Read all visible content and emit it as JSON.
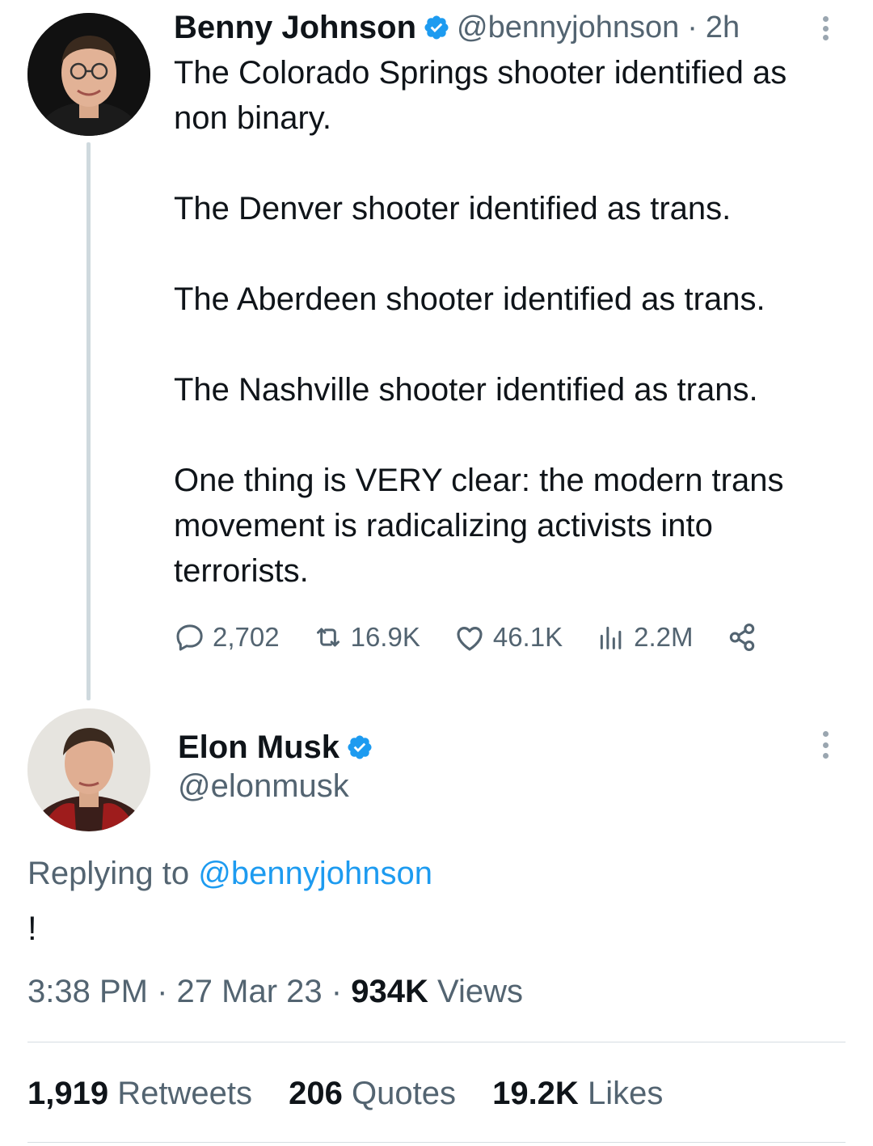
{
  "thread_post": {
    "author": {
      "display_name": "Benny Johnson",
      "handle": "@bennyjohnson",
      "separator": "·",
      "time": "2h"
    },
    "paragraphs": [
      "The Colorado Springs shooter identified as non binary.",
      "The Denver shooter identified as trans.",
      "The Aberdeen shooter identified as trans.",
      "The Nashville shooter identified as trans.",
      "One thing is VERY clear: the modern trans movement is radicalizing activists into terrorists."
    ],
    "actions": {
      "replies": "2,702",
      "retweets": "16.9K",
      "likes": "46.1K",
      "views": "2.2M"
    }
  },
  "reply_post": {
    "author": {
      "display_name": "Elon Musk",
      "handle": "@elonmusk"
    },
    "replying_to_label": "Replying to",
    "replying_to_handle": "@bennyjohnson",
    "text": "!",
    "meta": {
      "time": "3:38 PM",
      "separator": "·",
      "date": "27 Mar 23",
      "views_count": "934K",
      "views_label": "Views"
    },
    "stats": {
      "retweets_count": "1,919",
      "retweets_label": "Retweets",
      "quotes_count": "206",
      "quotes_label": "Quotes",
      "likes_count": "19.2K",
      "likes_label": "Likes"
    }
  },
  "colors": {
    "accent": "#1d9bf0",
    "secondary_text": "#536471",
    "primary_text": "#0f1419",
    "thread_line": "#cfd9de"
  },
  "icons": [
    "verified-badge-icon",
    "more-icon",
    "reply-icon",
    "retweet-icon",
    "like-icon",
    "views-icon",
    "share-icon"
  ]
}
